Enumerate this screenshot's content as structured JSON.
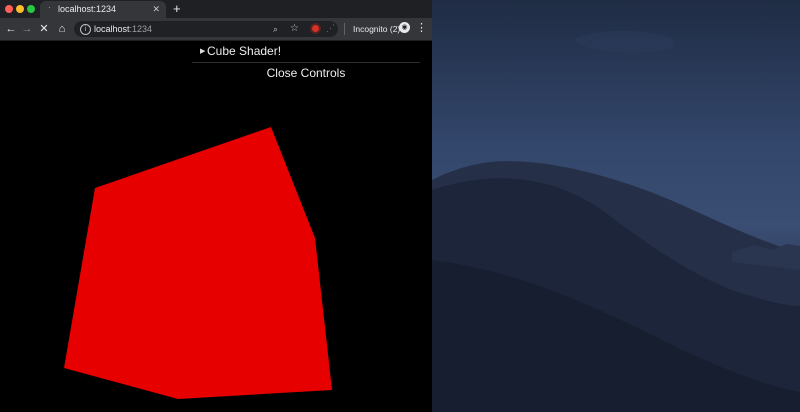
{
  "browser": {
    "tab": {
      "title": "localhost:1234"
    },
    "url": {
      "host": "localhost",
      "port": ":1234"
    },
    "incognito_label": "Incognito (2)"
  },
  "icons": {
    "back": "arrow-left-icon",
    "forward": "arrow-right-icon",
    "stop": "close-icon",
    "home": "home-icon",
    "info": "info-icon",
    "zoom": "zoom-icon",
    "bookmark": "star-icon",
    "record": "record-icon",
    "menu": "more-vert-icon"
  },
  "controls": {
    "folder_title": "Cube Shader!",
    "close_label": "Close Controls"
  },
  "colors": {
    "cube": "#e60000",
    "canvas": "#000000",
    "tab_active": "#35363a",
    "record": "#d93025"
  }
}
